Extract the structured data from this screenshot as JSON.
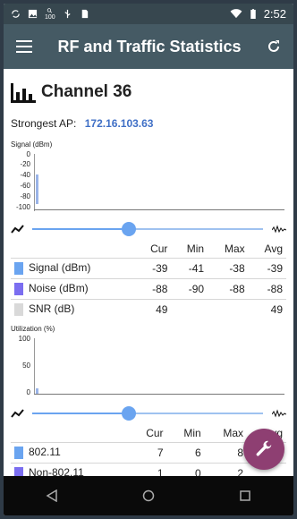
{
  "status_bar": {
    "time": "2:52",
    "battery_percent": "100"
  },
  "app_bar": {
    "title": "RF and Traffic Statistics",
    "menu_icon": "hamburger-menu-icon",
    "refresh_icon": "refresh-icon"
  },
  "channel": {
    "icon": "signal-bars-icon",
    "name": "Channel 36"
  },
  "strongest_ap": {
    "label": "Strongest AP:",
    "ip": "172.16.103.63"
  },
  "signal_chart": {
    "label": "Signal (dBm)",
    "ticks": [
      "0",
      "-20",
      "-40",
      "-60",
      "-80",
      "-100"
    ],
    "slider_position": 0.42,
    "columns": [
      "",
      "Cur",
      "Min",
      "Max",
      "Avg"
    ],
    "rows": [
      {
        "label": "Signal (dBm)",
        "color": "#6aa4f0",
        "cur": "-39",
        "min": "-41",
        "max": "-38",
        "avg": "-39"
      },
      {
        "label": "Noise (dBm)",
        "color": "#7b6ef0",
        "cur": "-88",
        "min": "-90",
        "max": "-88",
        "avg": "-88"
      },
      {
        "label": "SNR (dB)",
        "color": "#d9d9d9",
        "cur": "49",
        "min": "",
        "max": "",
        "avg": "49"
      }
    ]
  },
  "util_chart": {
    "label": "Utilization (%)",
    "ticks": [
      "100",
      "50",
      "0"
    ],
    "slider_position": 0.42,
    "columns": [
      "",
      "Cur",
      "Min",
      "Max",
      "Avg"
    ],
    "rows": [
      {
        "label": "802.11",
        "color": "#6aa4f0",
        "cur": "7",
        "min": "6",
        "max": "8",
        "avg": ""
      },
      {
        "label": "Non-802.11",
        "color": "#7b6ef0",
        "cur": "1",
        "min": "0",
        "max": "2",
        "avg": ""
      }
    ]
  },
  "fab": {
    "icon": "wrench-icon"
  },
  "nav_bar": {
    "back_icon": "back-triangle-icon",
    "home_icon": "home-circle-icon",
    "recents_icon": "recents-square-icon"
  }
}
